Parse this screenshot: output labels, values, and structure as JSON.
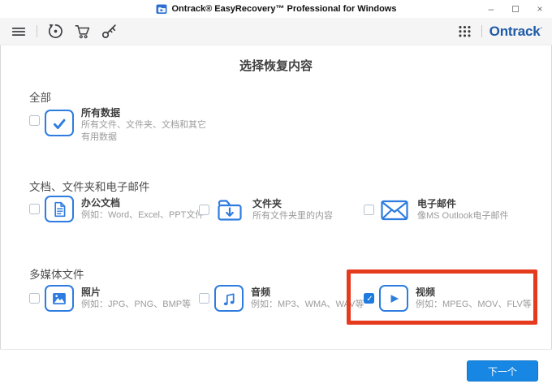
{
  "window": {
    "title": "Ontrack® EasyRecovery™ Professional for Windows",
    "minimize_glyph": "–",
    "close_glyph": "×"
  },
  "toolbar": {
    "left_icon_names": [
      "menu-icon",
      "history-icon",
      "cart-icon",
      "key-icon"
    ],
    "right_icon_names": [
      "apps-grid-icon"
    ],
    "brand": "Ontrack",
    "brand_mark": "·"
  },
  "page": {
    "heading": "选择恢复内容",
    "sections": [
      {
        "label": "全部",
        "items": [
          {
            "title": "所有数据",
            "desc": "所有文件、文件夹、文档和其它",
            "desc2": "有用数据",
            "checked": false,
            "icon": "check"
          }
        ]
      },
      {
        "label": "文档、文件夹和电子邮件",
        "items": [
          {
            "title": "办公文档",
            "desc": "例如：Word、Excel、PPT文件",
            "checked": false,
            "icon": "document"
          },
          {
            "title": "文件夹",
            "desc": "所有文件夹里的内容",
            "checked": false,
            "icon": "folder-download"
          },
          {
            "title": "电子邮件",
            "desc": "像MS Outlook电子邮件",
            "checked": false,
            "icon": "envelope"
          }
        ]
      },
      {
        "label": "多媒体文件",
        "items": [
          {
            "title": "照片",
            "desc": "例如：JPG、PNG、BMP等",
            "checked": false,
            "icon": "image"
          },
          {
            "title": "音频",
            "desc": "例如：MP3、WMA、WAV等",
            "checked": false,
            "icon": "music-note"
          },
          {
            "title": "视频",
            "desc": "例如：MPEG、MOV、FLV等",
            "checked": true,
            "icon": "play",
            "highlighted": true
          }
        ]
      }
    ]
  },
  "footer": {
    "next_label": "下一个"
  },
  "colors": {
    "accent_blue": "#2e7ce0",
    "checked_blue": "#1e7ce0",
    "button_blue": "#1787e3",
    "brand_blue": "#1f5ba8",
    "highlight_red": "#e63a1e"
  }
}
